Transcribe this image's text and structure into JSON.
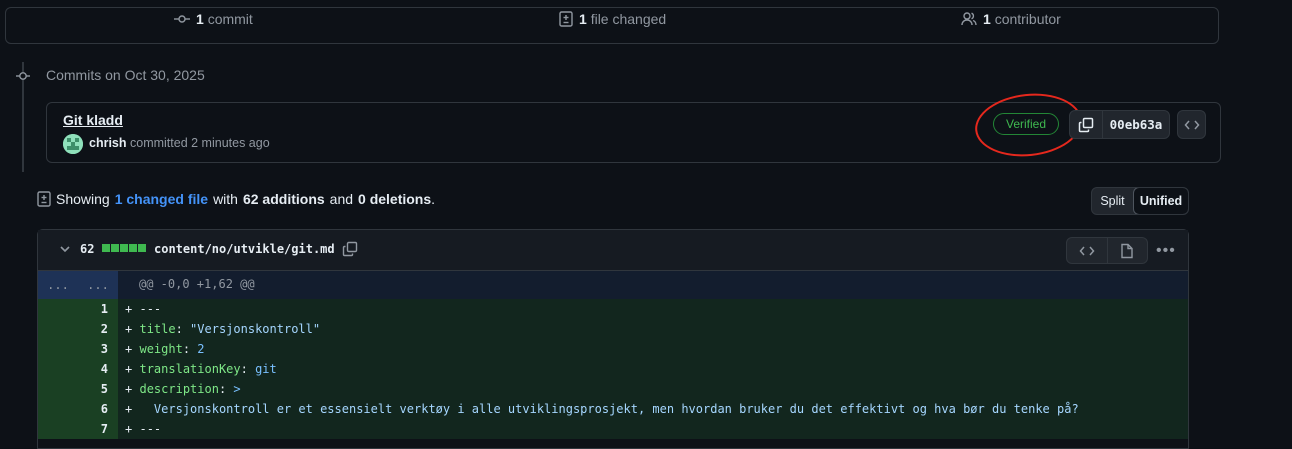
{
  "summary": {
    "commits_count": "1",
    "commits_label": "commit",
    "files_count": "1",
    "files_label": "file changed",
    "contributors_count": "1",
    "contributors_label": "contributor"
  },
  "timeline": {
    "heading": "Commits on Oct 30, 2025"
  },
  "commit": {
    "title": "Git kladd",
    "author": "chrish",
    "meta": "committed 2 minutes ago",
    "badge": "Verified",
    "sha": "00eb63a"
  },
  "diff_summary": {
    "prefix": "Showing",
    "changed_link": "1 changed file",
    "with": "with",
    "additions": "62 additions",
    "and": "and",
    "deletions": "0 deletions",
    "suffix": "."
  },
  "view_toggle": {
    "split": "Split",
    "unified": "Unified",
    "selected": "Unified"
  },
  "file": {
    "additions": "62",
    "path": "content/no/utvikle/git.md",
    "hunk_gutter_old": "...",
    "hunk_gutter_new": "...",
    "hunk_header": "@@ -0,0 +1,62 @@",
    "lines": [
      {
        "num": "1",
        "marker": "+",
        "key": "---",
        "sep": "",
        "val": ""
      },
      {
        "num": "2",
        "marker": "+",
        "key": "title",
        "sep": ": ",
        "val": "\"Versjonskontroll\""
      },
      {
        "num": "3",
        "marker": "+",
        "key": "weight",
        "sep": ": ",
        "val": "2"
      },
      {
        "num": "4",
        "marker": "+",
        "key": "translationKey",
        "sep": ": ",
        "val": "git"
      },
      {
        "num": "5",
        "marker": "+",
        "key": "description",
        "sep": ": ",
        "val": ">"
      },
      {
        "num": "6",
        "marker": "+",
        "key": "",
        "sep": "",
        "val": "  Versjonskontroll er et essensielt verktøy i alle utviklingsprosjekt, men hvordan bruker du det effektivt og hva bør du tenke på?"
      },
      {
        "num": "7",
        "marker": "+",
        "key": "---",
        "sep": "",
        "val": ""
      }
    ]
  },
  "colors": {
    "background": "#0d1117",
    "accent_link": "#4493f8",
    "verified_green": "#3fb950",
    "annotation_red": "#e5281d",
    "addition_bg": "#12261e"
  }
}
